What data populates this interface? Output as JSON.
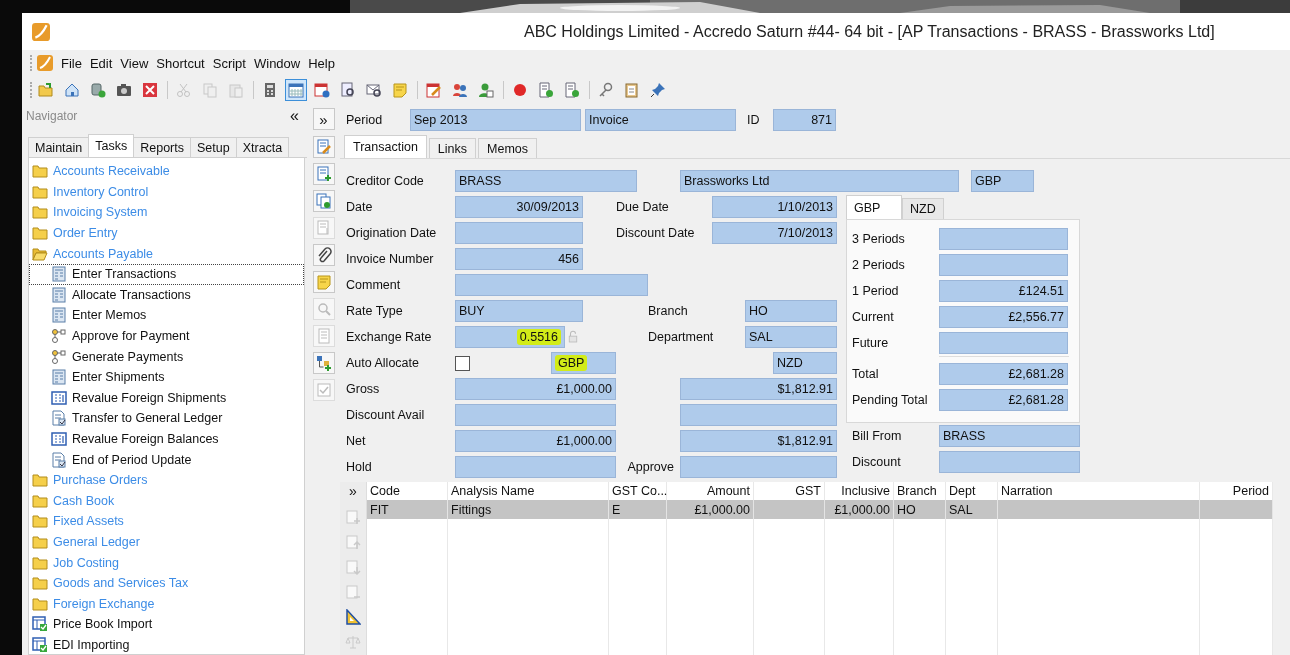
{
  "window": {
    "title": "ABC Holdings Limited - Accredo Saturn #44- 64 bit - [AP Transactions - BRASS - Brassworks Ltd]"
  },
  "menu": [
    "File",
    "Edit",
    "View",
    "Shortcut",
    "Script",
    "Window",
    "Help"
  ],
  "toolbar": [
    {
      "kind": "open",
      "disabled": false,
      "pressed": false
    },
    {
      "kind": "home",
      "disabled": false,
      "pressed": false
    },
    {
      "kind": "refresh",
      "disabled": false,
      "pressed": false
    },
    {
      "kind": "camera",
      "disabled": false,
      "pressed": false
    },
    {
      "kind": "close",
      "disabled": false,
      "pressed": false
    },
    {
      "kind": "sep"
    },
    {
      "kind": "cut",
      "disabled": true,
      "pressed": false
    },
    {
      "kind": "copy",
      "disabled": true,
      "pressed": false
    },
    {
      "kind": "paste",
      "disabled": true,
      "pressed": false
    },
    {
      "kind": "sep"
    },
    {
      "kind": "calc",
      "disabled": false,
      "pressed": false
    },
    {
      "kind": "calendar",
      "disabled": false,
      "pressed": true
    },
    {
      "kind": "calinfo",
      "disabled": false,
      "pressed": false
    },
    {
      "kind": "docsearch",
      "disabled": false,
      "pressed": false
    },
    {
      "kind": "mailsearch",
      "disabled": false,
      "pressed": false
    },
    {
      "kind": "note",
      "disabled": false,
      "pressed": false
    },
    {
      "kind": "sep"
    },
    {
      "kind": "caledit",
      "disabled": false,
      "pressed": false
    },
    {
      "kind": "people",
      "disabled": false,
      "pressed": false
    },
    {
      "kind": "personcheck",
      "disabled": false,
      "pressed": false
    },
    {
      "kind": "sep"
    },
    {
      "kind": "record",
      "disabled": false,
      "pressed": false
    },
    {
      "kind": "script",
      "disabled": false,
      "pressed": false
    },
    {
      "kind": "script",
      "disabled": false,
      "pressed": false
    },
    {
      "kind": "sep"
    },
    {
      "kind": "key",
      "disabled": false,
      "pressed": false
    },
    {
      "kind": "clipboard",
      "disabled": false,
      "pressed": false
    },
    {
      "kind": "pin",
      "disabled": false,
      "pressed": false
    }
  ],
  "navigator": {
    "title": "Navigator",
    "collapse": "«",
    "tabs": [
      {
        "label": "Maintain",
        "selected": false
      },
      {
        "label": "Tasks",
        "selected": true
      },
      {
        "label": "Reports",
        "selected": false
      },
      {
        "label": "Setup",
        "selected": false
      },
      {
        "label": "Xtracta",
        "selected": false
      }
    ],
    "tree": [
      {
        "label": "Accounts Receivable",
        "kind": "folder",
        "expanded": false,
        "selected": false
      },
      {
        "label": "Inventory Control",
        "kind": "folder",
        "expanded": false,
        "selected": false
      },
      {
        "label": "Invoicing System",
        "kind": "folder",
        "expanded": false,
        "selected": false
      },
      {
        "label": "Order Entry",
        "kind": "folder",
        "expanded": false,
        "selected": false
      },
      {
        "label": "Accounts Payable",
        "kind": "folder",
        "expanded": true,
        "selected": false,
        "children": [
          {
            "label": "Enter Transactions",
            "kind": "form",
            "selected": true
          },
          {
            "label": "Allocate Transactions",
            "kind": "form",
            "selected": false
          },
          {
            "label": "Enter Memos",
            "kind": "form",
            "selected": false
          },
          {
            "label": "Approve for Payment",
            "kind": "workflow",
            "selected": false
          },
          {
            "label": "Generate Payments",
            "kind": "workflow",
            "selected": false
          },
          {
            "label": "Enter Shipments",
            "kind": "form",
            "selected": false
          },
          {
            "label": "Revalue Foreign Shipments",
            "kind": "grid",
            "selected": false
          },
          {
            "label": "Transfer to General Ledger",
            "kind": "report",
            "selected": false
          },
          {
            "label": "Revalue Foreign Balances",
            "kind": "grid",
            "selected": false
          },
          {
            "label": "End of Period Update",
            "kind": "report",
            "selected": false
          }
        ]
      },
      {
        "label": "Purchase Orders",
        "kind": "folder",
        "expanded": false,
        "selected": false
      },
      {
        "label": "Cash Book",
        "kind": "folder",
        "expanded": false,
        "selected": false
      },
      {
        "label": "Fixed Assets",
        "kind": "folder",
        "expanded": false,
        "selected": false
      },
      {
        "label": "General Ledger",
        "kind": "folder",
        "expanded": false,
        "selected": false
      },
      {
        "label": "Job Costing",
        "kind": "folder",
        "expanded": false,
        "selected": false
      },
      {
        "label": "Goods and Services Tax",
        "kind": "folder",
        "expanded": false,
        "selected": false
      },
      {
        "label": "Foreign Exchange",
        "kind": "folder",
        "expanded": false,
        "selected": false
      },
      {
        "label": "Price Book Import",
        "kind": "import",
        "selected": false
      },
      {
        "label": "EDI Importing",
        "kind": "import",
        "selected": false
      }
    ]
  },
  "side_toolbar": {
    "expand": "»",
    "buttons": [
      {
        "kind": "docedit",
        "disabled": false
      },
      {
        "kind": "docadd",
        "disabled": false
      },
      {
        "kind": "docs",
        "disabled": false
      },
      {
        "kind": "docdown",
        "disabled": true
      },
      {
        "kind": "clip",
        "disabled": false
      },
      {
        "kind": "note",
        "disabled": false
      },
      {
        "kind": "search",
        "disabled": true
      },
      {
        "kind": "list",
        "disabled": true
      },
      {
        "kind": "treeadd",
        "disabled": false
      },
      {
        "kind": "check",
        "disabled": true
      }
    ]
  },
  "header": {
    "period_label": "Period",
    "period": "Sep 2013",
    "type": "Invoice",
    "id_label": "ID",
    "id": "871"
  },
  "tabs": [
    {
      "label": "Transaction",
      "selected": true
    },
    {
      "label": "Links",
      "selected": false
    },
    {
      "label": "Memos",
      "selected": false
    }
  ],
  "form": {
    "creditor": {
      "label": "Creditor Code",
      "code": "BRASS",
      "name": "Brassworks Ltd",
      "currency": "GBP"
    },
    "rows": [
      {
        "items": [
          {
            "kind": "label",
            "text": "Date"
          },
          {
            "kind": "field",
            "value": "30/09/2013"
          },
          {
            "kind": "label",
            "text": "Due Date"
          },
          {
            "kind": "field",
            "value": "1/10/2013"
          }
        ]
      },
      {
        "items": [
          {
            "kind": "label",
            "text": "Origination Date"
          },
          {
            "kind": "field"
          },
          {
            "kind": "label",
            "text": "Discount Date"
          },
          {
            "kind": "field",
            "value": "7/10/2013"
          }
        ]
      },
      {
        "items": [
          {
            "kind": "label",
            "text": "Invoice Number"
          },
          {
            "kind": "field",
            "value": "456"
          }
        ]
      },
      {
        "items": [
          {
            "kind": "label",
            "text": "Comment"
          },
          {
            "kind": "field"
          }
        ]
      },
      {
        "items": [
          {
            "kind": "label",
            "text": "Rate Type"
          },
          {
            "kind": "field",
            "value": "BUY"
          },
          {
            "kind": "label",
            "text": "Branch"
          },
          {
            "kind": "field",
            "value": "HO"
          }
        ]
      },
      {
        "items": [
          {
            "kind": "label",
            "text": "Exchange Rate"
          },
          {
            "kind": "field",
            "value": "0.5516",
            "highlighted": true,
            "locked": true
          },
          {
            "kind": "label",
            "text": "Department"
          },
          {
            "kind": "field",
            "value": "SAL"
          }
        ]
      },
      {
        "items": [
          {
            "kind": "label",
            "text": "Auto Allocate"
          },
          {
            "kind": "checkbox",
            "checked": false
          },
          {
            "kind": "field",
            "value": "GBP",
            "highlighted": true
          },
          {
            "kind": "field",
            "value": "NZD"
          }
        ]
      },
      {
        "items": [
          {
            "kind": "label",
            "text": "Gross"
          },
          {
            "kind": "field",
            "value": "£1,000.00"
          },
          {
            "kind": "field",
            "value": "$1,812.91"
          }
        ]
      },
      {
        "items": [
          {
            "kind": "label",
            "text": "Discount Avail"
          },
          {
            "kind": "field"
          },
          {
            "kind": "field"
          }
        ]
      },
      {
        "items": [
          {
            "kind": "label",
            "text": "Net"
          },
          {
            "kind": "field",
            "value": "£1,000.00"
          },
          {
            "kind": "field",
            "value": "$1,812.91"
          }
        ]
      },
      {
        "items": [
          {
            "kind": "label",
            "text": "Hold"
          },
          {
            "kind": "field"
          },
          {
            "kind": "label",
            "text": "Approve"
          },
          {
            "kind": "field"
          }
        ]
      }
    ]
  },
  "aging": {
    "tabs": [
      {
        "label": "GBP",
        "selected": true
      },
      {
        "label": "NZD",
        "selected": false
      }
    ],
    "rows": [
      {
        "label": "3 Periods"
      },
      {
        "label": "2 Periods"
      },
      {
        "label": "1 Period",
        "value": "£124.51"
      },
      {
        "label": "Current",
        "value": "£2,556.77"
      },
      {
        "label": "Future"
      }
    ],
    "totals": [
      {
        "label": "Total",
        "value": "£2,681.28"
      },
      {
        "label": "Pending Total",
        "value": "£2,681.28"
      }
    ]
  },
  "billing": [
    {
      "label": "Bill From",
      "value": "BRASS"
    },
    {
      "label": "Discount"
    }
  ],
  "grid": {
    "expand": "»",
    "columns": [
      "Code",
      "Analysis Name",
      "GST Co...",
      "Amount",
      "GST",
      "Inclusive",
      "Branch",
      "Dept",
      "Narration",
      "Period"
    ],
    "rows": [
      {
        "selected": true,
        "cells": [
          "FIT",
          "Fittings",
          "E",
          "£1,000.00",
          null,
          "£1,000.00",
          "HO",
          "SAL",
          null,
          null
        ]
      }
    ],
    "tools": [
      {
        "kind": "rowadd",
        "disabled": true
      },
      {
        "kind": "rowup",
        "disabled": true
      },
      {
        "kind": "rowdown",
        "disabled": true
      },
      {
        "kind": "rowdel",
        "disabled": true
      },
      {
        "kind": "ruler",
        "disabled": false
      },
      {
        "kind": "scales",
        "disabled": true
      }
    ]
  }
}
